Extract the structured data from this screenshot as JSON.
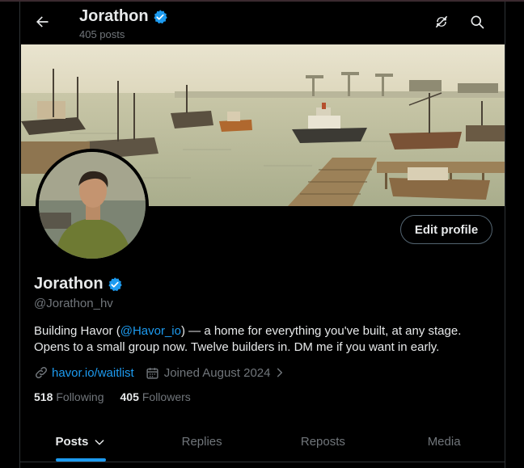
{
  "header": {
    "name": "Jorathon",
    "posts_count": "405 posts"
  },
  "profile": {
    "display_name": "Jorathon",
    "handle": "@Jorathon_hv",
    "edit_label": "Edit profile",
    "bio_pre": "Building Havor (",
    "bio_mention": "@Havor_io",
    "bio_post": ") — a home for everything you've built, at any stage. Opens to a small group now. Twelve builders in.  DM me if you want in early.",
    "website": "havor.io/waitlist",
    "joined": "Joined August 2024",
    "following_count": "518",
    "following_label": "Following",
    "followers_count": "405",
    "followers_label": "Followers"
  },
  "tabs": [
    {
      "label": "Posts"
    },
    {
      "label": "Replies"
    },
    {
      "label": "Reposts"
    },
    {
      "label": "Media"
    }
  ],
  "colors": {
    "accent": "#1d9bf0",
    "background": "#000000",
    "muted": "#71767b"
  },
  "icons": [
    "back-arrow-icon",
    "verified-badge-icon",
    "refresh-icon",
    "search-icon",
    "link-icon",
    "calendar-icon",
    "chevron-right-icon",
    "chevron-down-icon"
  ]
}
